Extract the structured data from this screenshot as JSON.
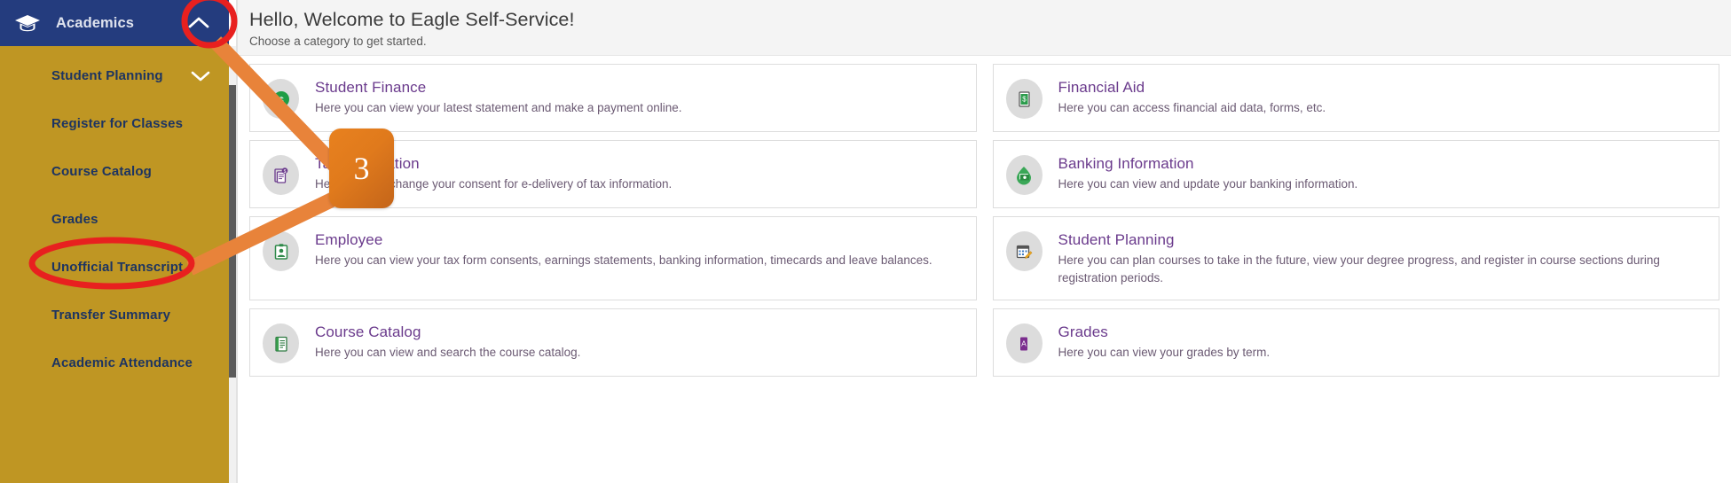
{
  "sidebar": {
    "header": {
      "title": "Academics",
      "icon": "graduation-cap-icon",
      "collapse_icon": "chevron-up-icon"
    },
    "items": [
      {
        "label": "Student Planning",
        "expand_icon": "chevron-down-icon"
      },
      {
        "label": "Register for Classes"
      },
      {
        "label": "Course Catalog"
      },
      {
        "label": "Grades"
      },
      {
        "label": "Unofficial Transcript"
      },
      {
        "label": "Transfer Summary"
      },
      {
        "label": "Academic Attendance"
      }
    ]
  },
  "header": {
    "title": "Hello, Welcome to Eagle Self-Service!",
    "subtitle": "Choose a category to get started."
  },
  "cards": [
    {
      "title": "Student Finance",
      "desc": "Here you can view your latest statement and make a payment online.",
      "icon": "money-drop-icon"
    },
    {
      "title": "Financial Aid",
      "desc": "Here you can access financial aid data, forms, etc.",
      "icon": "dollar-document-icon"
    },
    {
      "title": "Tax Information",
      "desc": "Here you can change your consent for e-delivery of tax information.",
      "icon": "tax-document-icon"
    },
    {
      "title": "Banking Information",
      "desc": "Here you can view and update your banking information.",
      "icon": "bank-money-icon"
    },
    {
      "title": "Employee",
      "desc": "Here you can view your tax form consents, earnings statements, banking information, timecards and leave balances.",
      "icon": "id-badge-icon"
    },
    {
      "title": "Student Planning",
      "desc": "Here you can plan courses to take in the future, view your degree progress, and register in course sections during registration periods.",
      "icon": "calendar-pencil-icon"
    },
    {
      "title": "Course Catalog",
      "desc": "Here you can view and search the course catalog.",
      "icon": "book-icon"
    },
    {
      "title": "Grades",
      "desc": "Here you can view your grades by term.",
      "icon": "grade-a-icon"
    }
  ],
  "annotations": {
    "step_badge": "3",
    "badge_color": "#E07A1C",
    "highlight_color": "#E8201F",
    "circle_target": "chevron-up-icon",
    "ellipse_target": "Unofficial Transcript"
  }
}
